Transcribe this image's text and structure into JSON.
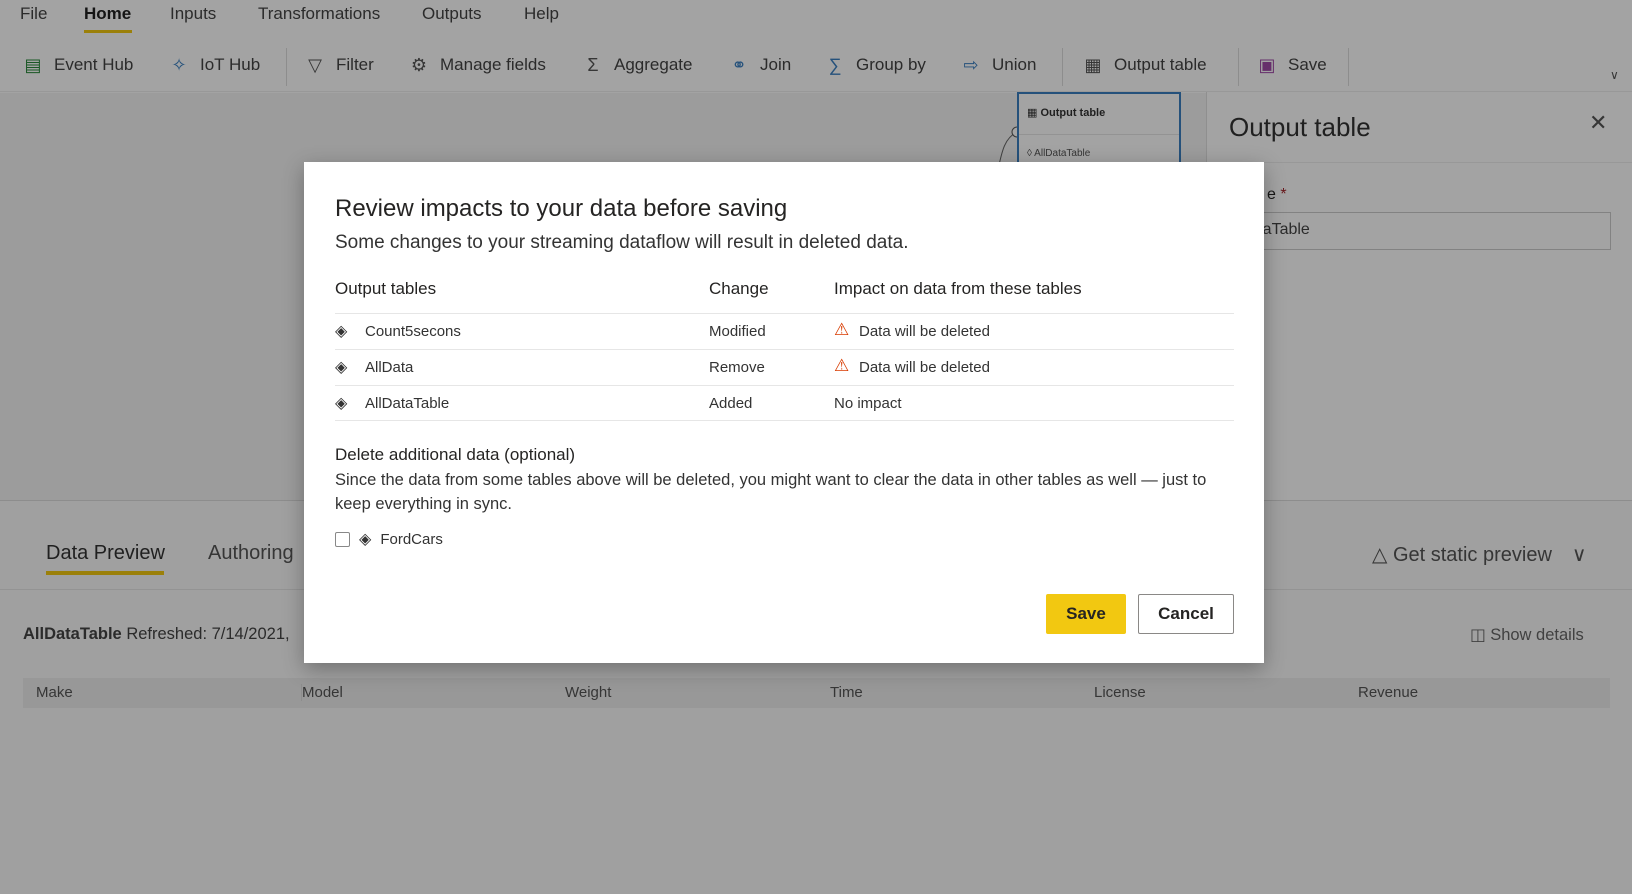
{
  "menu": {
    "items": [
      "File",
      "Home",
      "Inputs",
      "Transformations",
      "Outputs",
      "Help"
    ],
    "active": "Home"
  },
  "toolbar": {
    "event_hub": "Event Hub",
    "iot_hub": "IoT Hub",
    "filter": "Filter",
    "manage_fields": "Manage fields",
    "aggregate": "Aggregate",
    "join": "Join",
    "group_by": "Group by",
    "union": "Union",
    "output_table": "Output table",
    "save": "Save"
  },
  "canvas": {
    "node_title": "Output table",
    "node_table": "AllDataTable"
  },
  "right_panel": {
    "title": "Output table",
    "name_label": "e",
    "required": "*",
    "name_value": "AllDataTable"
  },
  "bottom": {
    "tabs": [
      "Data Preview",
      "Authoring"
    ],
    "static_preview": "Get static preview",
    "table_name": "AllDataTable",
    "refreshed": "Refreshed: 7/14/2021,",
    "show_details": "Show details",
    "columns": [
      "Make",
      "Model",
      "Weight",
      "Time",
      "License",
      "Revenue"
    ]
  },
  "dialog": {
    "title": "Review impacts to your data before saving",
    "subtitle": "Some changes to your streaming dataflow will result in deleted data.",
    "headers": [
      "Output tables",
      "Change",
      "Impact on data from these tables"
    ],
    "rows": [
      {
        "table": "Count5secons",
        "change": "Modified",
        "impact": "Data will be deleted",
        "warning": true
      },
      {
        "table": "AllData",
        "change": "Remove",
        "impact": "Data will be deleted",
        "warning": true
      },
      {
        "table": "AllDataTable",
        "change": "Added",
        "impact": "No impact",
        "warning": false
      }
    ],
    "section_title": "Delete additional data (optional)",
    "section_text": "Since the data from some tables above will be deleted, you might want to clear the data in other tables as well — just to keep everything in sync.",
    "checkbox_label": "FordCars",
    "checkbox_checked": false,
    "save": "Save",
    "cancel": "Cancel"
  },
  "colors": {
    "accent": "#f2c811",
    "warning": "#d83b01"
  }
}
